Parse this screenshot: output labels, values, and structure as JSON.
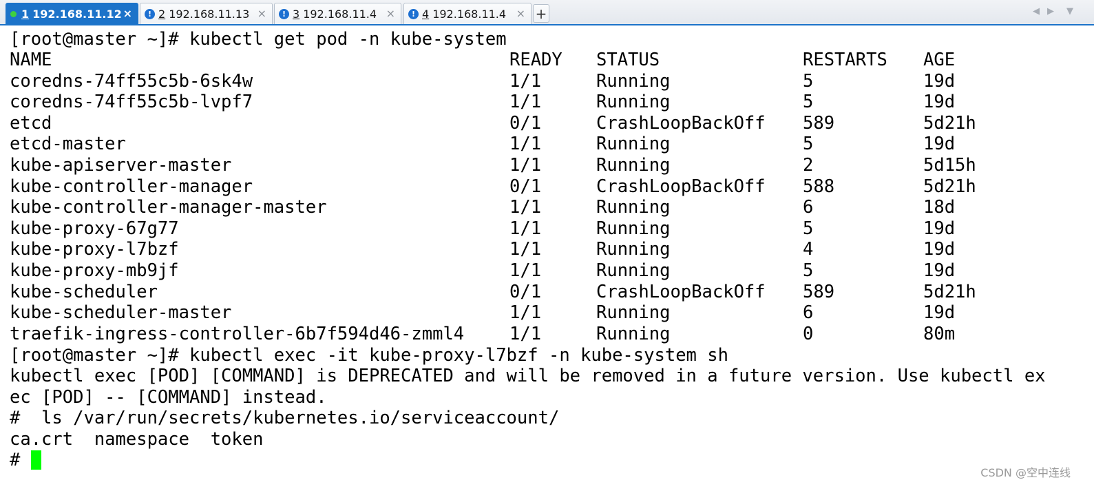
{
  "tabs": [
    {
      "num": "1",
      "host": "192.168.11.12",
      "status": "connected",
      "active": true
    },
    {
      "num": "2",
      "host": "192.168.11.13",
      "status": "alert",
      "active": false
    },
    {
      "num": "3",
      "host": "192.168.11.4",
      "status": "alert",
      "active": false
    },
    {
      "num": "4",
      "host": "192.168.11.4",
      "status": "alert",
      "active": false
    }
  ],
  "tab_close_glyph": "×",
  "add_tab_glyph": "+",
  "nav": {
    "prev": "◀",
    "next": "▶",
    "menu": "▼"
  },
  "terminal": {
    "command1": "[root@master ~]# kubectl get pod -n kube-system",
    "columns": [
      "NAME",
      "READY",
      "STATUS",
      "RESTARTS",
      "AGE"
    ],
    "pods": [
      [
        "coredns-74ff55c5b-6sk4w",
        "1/1",
        "Running",
        "5",
        "19d"
      ],
      [
        "coredns-74ff55c5b-lvpf7",
        "1/1",
        "Running",
        "5",
        "19d"
      ],
      [
        "etcd",
        "0/1",
        "CrashLoopBackOff",
        "589",
        "5d21h"
      ],
      [
        "etcd-master",
        "1/1",
        "Running",
        "5",
        "19d"
      ],
      [
        "kube-apiserver-master",
        "1/1",
        "Running",
        "2",
        "5d15h"
      ],
      [
        "kube-controller-manager",
        "0/1",
        "CrashLoopBackOff",
        "588",
        "5d21h"
      ],
      [
        "kube-controller-manager-master",
        "1/1",
        "Running",
        "6",
        "18d"
      ],
      [
        "kube-proxy-67g77",
        "1/1",
        "Running",
        "5",
        "19d"
      ],
      [
        "kube-proxy-l7bzf",
        "1/1",
        "Running",
        "4",
        "19d"
      ],
      [
        "kube-proxy-mb9jf",
        "1/1",
        "Running",
        "5",
        "19d"
      ],
      [
        "kube-scheduler",
        "0/1",
        "CrashLoopBackOff",
        "589",
        "5d21h"
      ],
      [
        "kube-scheduler-master",
        "1/1",
        "Running",
        "6",
        "19d"
      ],
      [
        "traefik-ingress-controller-6b7f594d46-zmml4",
        "1/1",
        "Running",
        "0",
        "80m"
      ]
    ],
    "command2": "[root@master ~]# kubectl exec -it kube-proxy-l7bzf -n kube-system sh",
    "warning_line1": "kubectl exec [POD] [COMMAND] is DEPRECATED and will be removed in a future version. Use kubectl ex",
    "warning_line2": "ec [POD] -- [COMMAND] instead.",
    "command3": "#  ls /var/run/secrets/kubernetes.io/serviceaccount/",
    "ls_output": "ca.crt  namespace  token",
    "prompt": "# "
  },
  "colors": {
    "accent": "#1c73c9",
    "connected_dot": "#3fd13f",
    "alert": "#1c6fd1",
    "cursor": "#00ff00"
  },
  "watermark": "CSDN @空中连线"
}
